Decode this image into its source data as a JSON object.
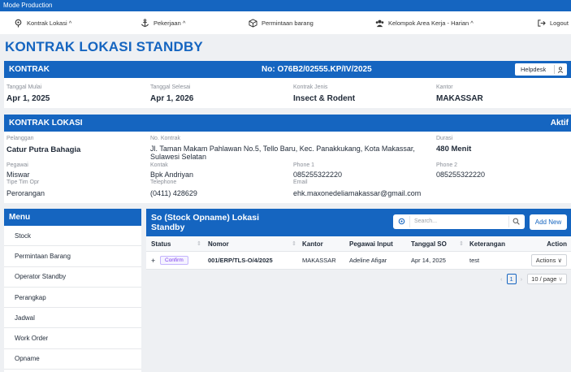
{
  "mode_bar": "Mode Production",
  "nav": {
    "kontrak_lokasi": "Kontrak Lokasi ^",
    "pekerjaan": "Pekerjaan ^",
    "permintaan_barang": "Permintaan barang",
    "kelompok": "Kelompok Area Kerja - Harian ^",
    "logout": "Logout"
  },
  "page_title": "KONTRAK LOKASI STANDBY",
  "kontrak": {
    "header": "KONTRAK",
    "nomor": "No: O76B2/02555.KP/IV/2025",
    "helpdesk": "Helpdesk",
    "tanggal_mulai_label": "Tanggal Mulai",
    "tanggal_mulai": "Apr 1, 2025",
    "tanggal_selesai_label": "Tanggal Selesai",
    "tanggal_selesai": "Apr 1, 2026",
    "kontrak_jenis_label": "Kontrak Jenis",
    "kontrak_jenis": "Insect & Rodent",
    "kantor_label": "Kantor",
    "kantor": "MAKASSAR"
  },
  "lokasi": {
    "header": "KONTRAK LOKASI",
    "status": "Aktif",
    "pelanggan_label": "Pelanggan",
    "pelanggan": "Catur Putra Bahagia",
    "no_kontrak_label": "No. Kontrak",
    "alamat_line1": "Jl. Taman Makam Pahlawan No.5, Tello Baru, Kec. Panakkukang, Kota Makassar,",
    "alamat_line2": "Sulawesi Selatan",
    "durasi_label": "Durasi",
    "durasi": "480 Menit",
    "pegawai_label": "Pegawai",
    "pegawai": "Miswar",
    "kontak_label": "Kontak",
    "kontak": "Bpk Andriyan",
    "phone1_label": "Phone 1",
    "phone1": "085255322220",
    "phone2_label": "Phone 2",
    "phone2": "085255322220",
    "tipe_tim_label": "Tipe Tim Opr",
    "tipe_tim": "Perorangan",
    "telephone_label": "Telephone",
    "telephone": "(0411) 428629",
    "email_label": "Email",
    "email": "ehk.maxonedeliamakassar@gmail.com"
  },
  "menu": {
    "header": "Menu",
    "items": [
      "Stock",
      "Permintaan Barang",
      "Operator Standby",
      "Perangkap",
      "Jadwal",
      "Work Order",
      "Opname"
    ]
  },
  "so": {
    "title_line1": "So (Stock Opname) Lokasi",
    "title_line2": "Standby",
    "search_placeholder": "Search...",
    "add_new": "Add New",
    "columns": {
      "status": "Status",
      "nomor": "Nomor",
      "kantor": "Kantor",
      "pegawai": "Pegawai Input",
      "tanggal": "Tanggal SO",
      "keterangan": "Keterangan",
      "action": "Action"
    },
    "rows": [
      {
        "expand": "+",
        "status": "Confirm",
        "nomor": "001/ERP/TLS-O/4/2025",
        "kantor": "MAKASSAR",
        "pegawai": "Adeline Afigar",
        "tanggal": "Apr 14, 2025",
        "keterangan": "test",
        "action": "Actions"
      }
    ],
    "pagination": {
      "current_page": "1",
      "page_size": "10 / page"
    }
  },
  "colors": {
    "primary": "#1565c0",
    "badge": "#7c3aed",
    "background": "#eef0f3"
  }
}
